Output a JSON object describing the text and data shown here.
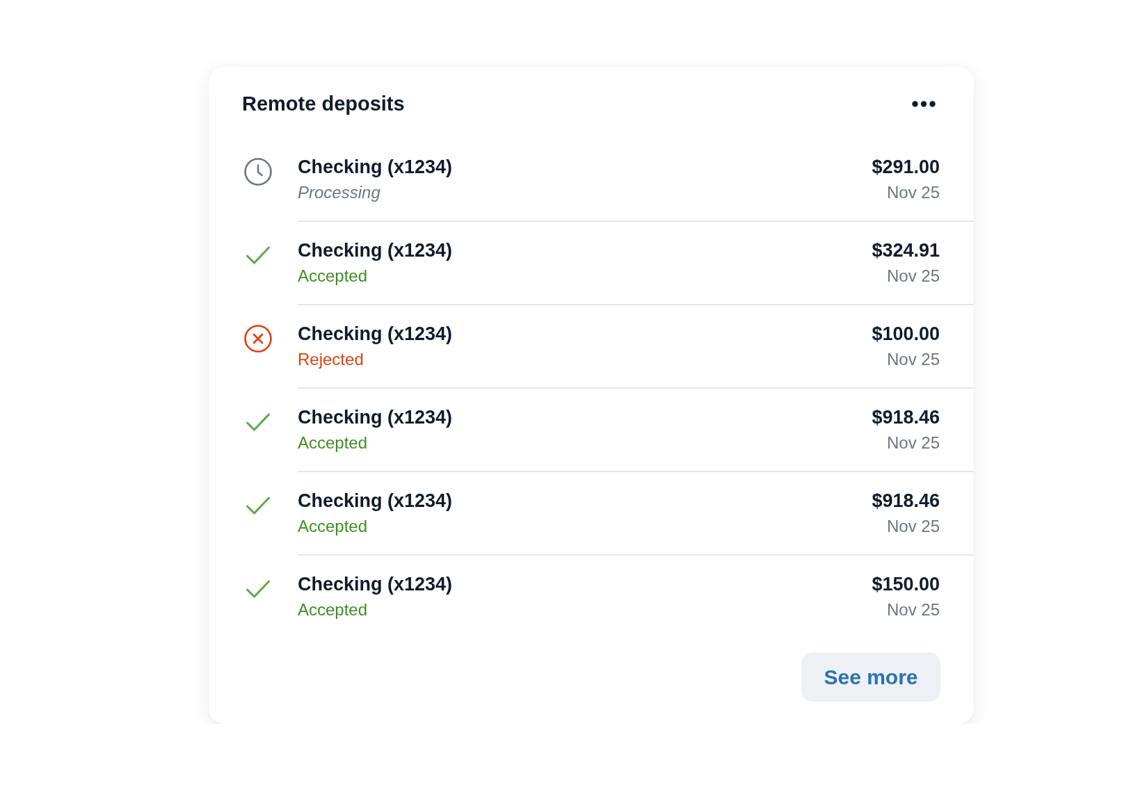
{
  "card": {
    "title": "Remote deposits",
    "deposits": [
      {
        "kind": "pending",
        "account": "Checking (x1234)",
        "status": "Processing",
        "amount": "$291.00",
        "date": "Nov 25"
      },
      {
        "kind": "accepted",
        "account": "Checking (x1234)",
        "status": "Accepted",
        "amount": "$324.91",
        "date": "Nov 25"
      },
      {
        "kind": "rejected",
        "account": "Checking (x1234)",
        "status": "Rejected",
        "amount": "$100.00",
        "date": "Nov 25"
      },
      {
        "kind": "accepted",
        "account": "Checking (x1234)",
        "status": "Accepted",
        "amount": "$918.46",
        "date": "Nov 25"
      },
      {
        "kind": "accepted",
        "account": "Checking (x1234)",
        "status": "Accepted",
        "amount": "$918.46",
        "date": "Nov 25"
      },
      {
        "kind": "accepted",
        "account": "Checking (x1234)",
        "status": "Accepted",
        "amount": "$150.00",
        "date": "Nov 25"
      }
    ],
    "see_more_button": "See more"
  }
}
